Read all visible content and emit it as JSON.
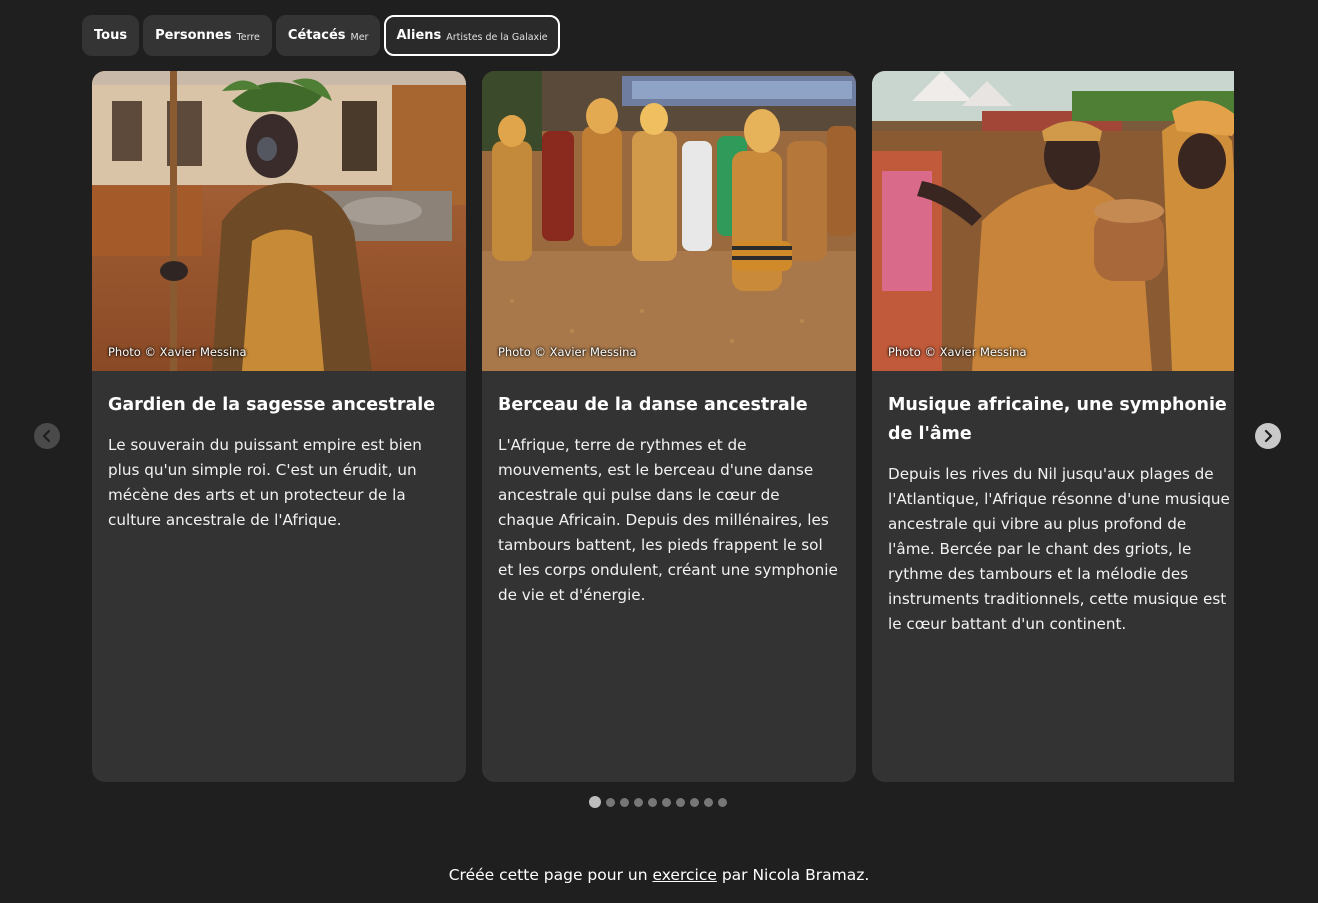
{
  "tabs": [
    {
      "label": "Tous",
      "sub": ""
    },
    {
      "label": "Personnes",
      "sub": "Terre"
    },
    {
      "label": "Cétacés",
      "sub": "Mer"
    },
    {
      "label": "Aliens",
      "sub": "Artistes de la Galaxie"
    }
  ],
  "active_tab": "Aliens",
  "cards": [
    {
      "credit": "Photo © Xavier Messina",
      "title": "Gardien de la sagesse ancestrale",
      "text": "Le souverain du puissant empire est bien plus qu'un simple roi. C'est un érudit, un mécène des arts et un protecteur de la culture ancestrale de l'Afrique."
    },
    {
      "credit": "Photo © Xavier Messina",
      "title": "Berceau de la danse ancestrale",
      "text": "L'Afrique, terre de rythmes et de mouvements, est le berceau d'une danse ancestrale qui pulse dans le cœur de chaque Africain. Depuis des millénaires, les tambours battent, les pieds frappent le sol et les corps ondulent, créant une symphonie de vie et d'énergie."
    },
    {
      "credit": "Photo © Xavier Messina",
      "title": "Musique africaine, une symphonie de l'âme",
      "text": "Depuis les rives du Nil jusqu'aux plages de l'Atlantique, l'Afrique résonne d'une musique ancestrale qui vibre au plus profond de l'âme. Bercée par le chant des griots, le rythme des tambours et la mélodie des instruments traditionnels, cette musique est le cœur battant d'un continent."
    }
  ],
  "carousel": {
    "dot_count": 10,
    "active_dot": 1
  },
  "icons": {
    "prev": "chevron-left-icon",
    "next": "chevron-right-icon"
  },
  "footer": {
    "before": "Créée cette page pour un",
    "link": "exercice",
    "after": "par Nicola Bramaz."
  }
}
